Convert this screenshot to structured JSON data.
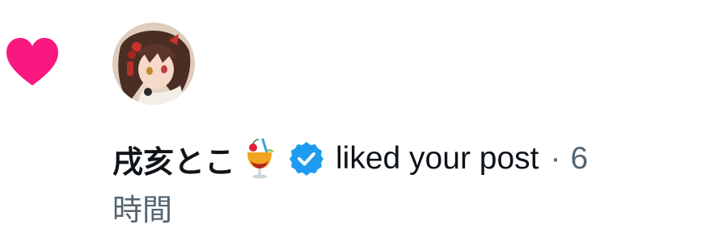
{
  "notification": {
    "type_icon": "heart-icon",
    "accent_color": "#f91880",
    "user": {
      "name": "戌亥とこ",
      "emoji": "tropical-drink-emoji",
      "verified": true,
      "verified_color": "#1d9bf0"
    },
    "action_text": "liked your post",
    "separator": "·",
    "time_value": "6",
    "time_unit": "時間"
  }
}
